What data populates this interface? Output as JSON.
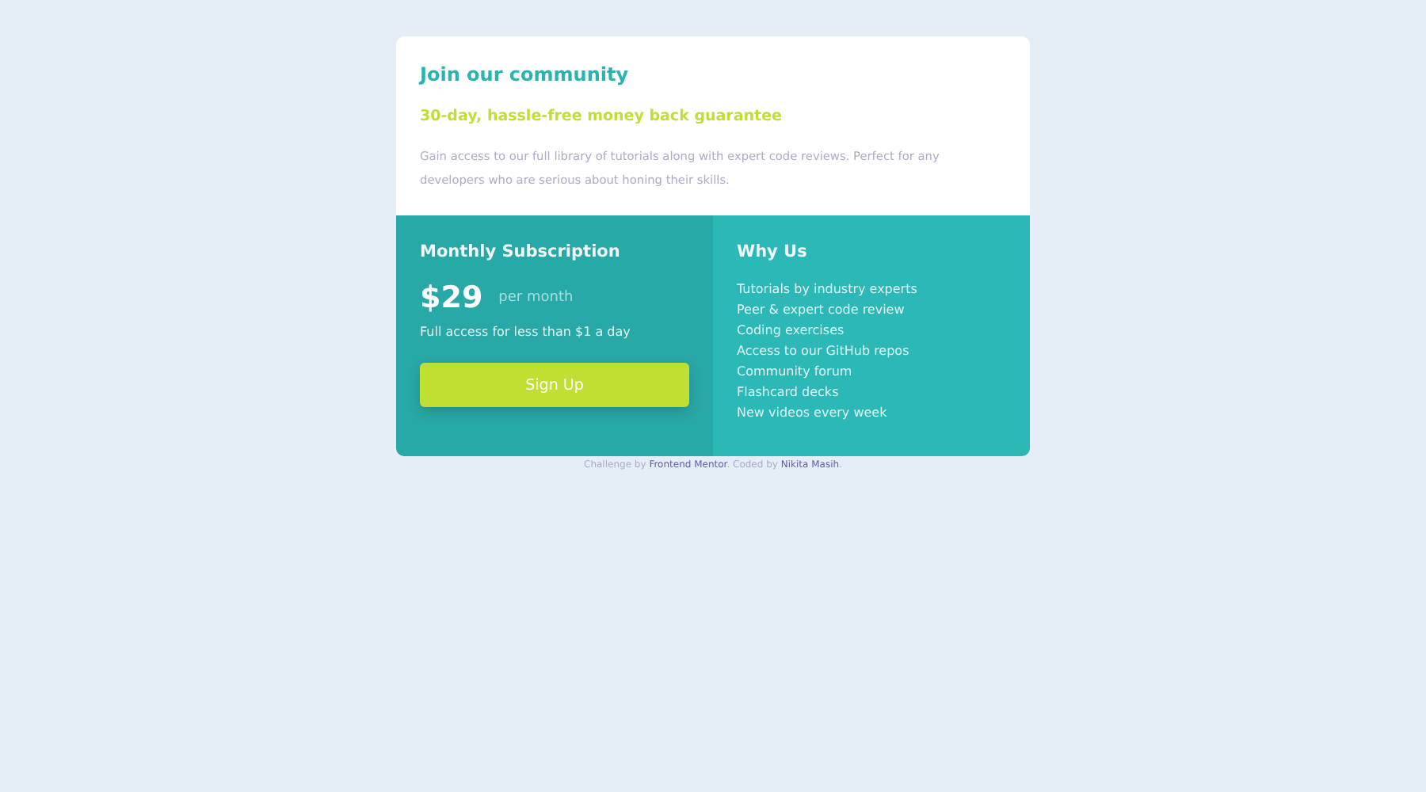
{
  "header": {
    "title": "Join our community",
    "subtitle": "30-day, hassle-free money back guarantee",
    "description": "Gain access to our full library of tutorials along with expert code reviews. Perfect for any developers who are serious about honing their skills."
  },
  "subscription": {
    "title": "Monthly Subscription",
    "price": "$29",
    "period": "per month",
    "note": "Full access for less than $1 a day",
    "button": "Sign Up"
  },
  "why_us": {
    "title": "Why Us",
    "items": [
      "Tutorials by industry experts",
      "Peer & expert code review",
      "Coding exercises",
      "Access to our GitHub repos",
      "Community forum",
      "Flashcard decks",
      "New videos every week"
    ]
  },
  "attribution": [
    {
      "kind": "text",
      "text": "Challenge by"
    },
    {
      "kind": "link",
      "text": "Frontend Mentor"
    },
    {
      "kind": "text",
      "text": ". Coded by"
    },
    {
      "kind": "link",
      "text": "Nikita Masih"
    },
    {
      "kind": "text",
      "text": "."
    }
  ]
}
